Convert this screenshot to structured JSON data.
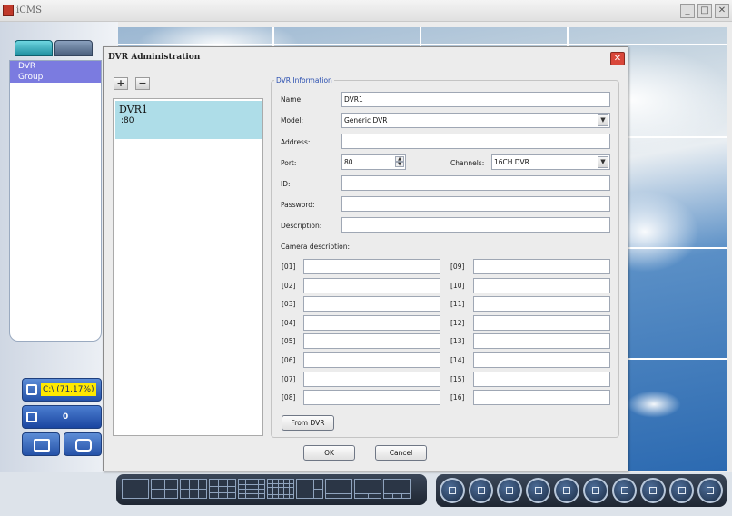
{
  "app": {
    "title": "iCMS",
    "minimize_glyph": "_",
    "maximize_glyph": "□",
    "close_glyph": "✕"
  },
  "left_panel": {
    "tree_items": [
      "DVR",
      "Group"
    ],
    "hdd_status": "C:\\ (71.17%)",
    "channel_count": "0"
  },
  "dialog": {
    "title": "DVR Administration",
    "close_glyph": "✕",
    "add_glyph": "+",
    "remove_glyph": "−",
    "dvr_list": [
      {
        "name": "DVR1",
        "port": ":80"
      }
    ],
    "group_title": "DVR Information",
    "labels": {
      "name": "Name:",
      "model": "Model:",
      "address": "Address:",
      "port": "Port:",
      "channels": "Channels:",
      "id": "ID:",
      "password": "Password:",
      "description": "Description:",
      "camera_description": "Camera description:"
    },
    "values": {
      "name": "DVR1",
      "model": "Generic DVR",
      "address": "",
      "port": "80",
      "channels": "16CH DVR",
      "id": "",
      "password": "",
      "description": ""
    },
    "camera_labels_left": [
      "[01]",
      "[02]",
      "[03]",
      "[04]",
      "[05]",
      "[06]",
      "[07]",
      "[08]"
    ],
    "camera_labels_right": [
      "[09]",
      "[10]",
      "[11]",
      "[12]",
      "[13]",
      "[14]",
      "[15]",
      "[16]"
    ],
    "camera_values": [
      "",
      "",
      "",
      "",
      "",
      "",
      "",
      "",
      "",
      "",
      "",
      "",
      "",
      "",
      "",
      ""
    ],
    "buttons": {
      "from_dvr": "From DVR",
      "ok": "OK",
      "cancel": "Cancel"
    }
  },
  "icons": {
    "app": "app-logo-icon",
    "combo": "chevron-down-icon",
    "spin_up": "spin-up-icon",
    "spin_down": "spin-down-icon"
  },
  "colors": {
    "selection": "#aedde8",
    "tree_highlight": "#7b7be0",
    "hdd_highlight": "#ffe900",
    "close_red": "#d9473a",
    "group_title": "#2a4fb0"
  }
}
